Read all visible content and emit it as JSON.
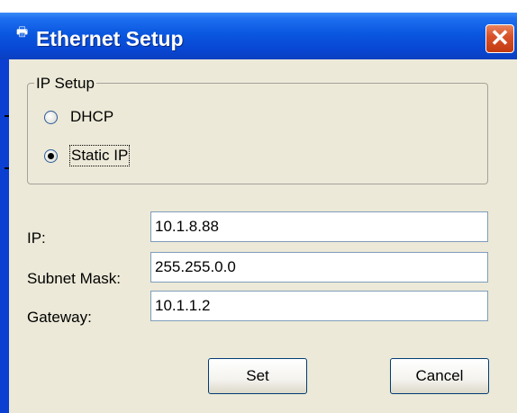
{
  "window": {
    "title": "Ethernet Setup",
    "close_label": "✕",
    "title_icon": "printer-icon"
  },
  "ip_setup": {
    "legend": "IP Setup",
    "options": [
      {
        "label": "DHCP",
        "selected": false
      },
      {
        "label": "Static IP",
        "selected": true
      }
    ]
  },
  "fields": {
    "ip": {
      "label": "IP:",
      "value": "10.1.8.88"
    },
    "subnet": {
      "label": "Subnet Mask:",
      "value": "255.255.0.0"
    },
    "gateway": {
      "label": "Gateway:",
      "value": "10.1.1.2"
    }
  },
  "buttons": {
    "set": "Set",
    "cancel": "Cancel"
  },
  "colors": {
    "titlebar": "#0a57e0",
    "client": "#ece9d8",
    "close": "#d9532a"
  }
}
